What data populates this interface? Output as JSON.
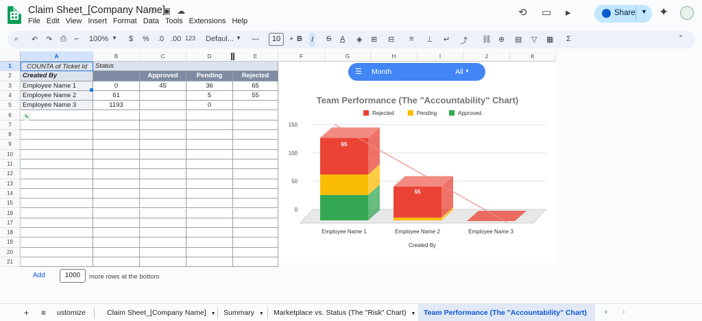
{
  "app": {
    "title": "Claim Sheet_[Company Name]"
  },
  "menu": [
    "File",
    "Edit",
    "View",
    "Insert",
    "Format",
    "Data",
    "Tools",
    "Extensions",
    "Help"
  ],
  "header": {
    "share_label": "Share"
  },
  "toolbar": {
    "zoom": "100%",
    "currency": "$",
    "percent": "%",
    "dec_decrease": ".0",
    "dec_increase": ".00",
    "number_format": "123",
    "font": "Defaul...",
    "font_size": "10",
    "bold": "B",
    "italic": "I",
    "sum": "Σ"
  },
  "columns": [
    "A",
    "B",
    "C",
    "D",
    "E",
    "F",
    "G",
    "H",
    "I",
    "J",
    "K"
  ],
  "rows": [
    "1",
    "2",
    "3",
    "4",
    "5",
    "6",
    "7",
    "8",
    "9",
    "10",
    "11",
    "12",
    "13",
    "14",
    "15",
    "16",
    "17",
    "18",
    "19",
    "20",
    "21"
  ],
  "table": {
    "a1": "COUNTA of Ticket Id",
    "b1": "Status",
    "a2": "Created By",
    "status_headers": [
      "Approved",
      "Pending",
      "Rejected"
    ],
    "rows": [
      {
        "name": "Employee Name 1",
        "total": "0",
        "approved": "45",
        "pending": "36",
        "rejected": "65"
      },
      {
        "name": "Employee Name 2",
        "total": "61",
        "approved": "",
        "pending": "5",
        "rejected": "55"
      },
      {
        "name": "Employee Name 3",
        "total": "1193",
        "approved": "",
        "pending": "0",
        "rejected": ""
      }
    ]
  },
  "filter": {
    "label": "Month",
    "value": "All"
  },
  "chart_data": {
    "type": "bar",
    "stacked": true,
    "three_d": true,
    "title": "Team Performance (The \"Accountability\" Chart)",
    "xlabel": "Created By",
    "ylabel": "",
    "categories": [
      "Employee Name 1",
      "Employee Name 2",
      "Employee Name 3"
    ],
    "series": [
      {
        "name": "Approved",
        "values": [
          45,
          0,
          0
        ],
        "color": "#34a853"
      },
      {
        "name": "Pending",
        "values": [
          36,
          5,
          0
        ],
        "color": "#fbbc04"
      },
      {
        "name": "Rejected",
        "values": [
          65,
          55,
          0
        ],
        "color": "#ea4335"
      }
    ],
    "legend_order": [
      "Rejected",
      "Pending",
      "Approved"
    ],
    "data_labels": {
      "Rejected": [
        "65",
        "55",
        ""
      ]
    },
    "yticks": [
      "150",
      "100",
      "50",
      "0"
    ],
    "ylim": [
      0,
      150
    ],
    "trendline": {
      "color": "#f28b82",
      "series": "Rejected"
    },
    "legend_position": "top",
    "grid": true
  },
  "bottom": {
    "add_label": "Add",
    "rows_count": "1000",
    "rows_text": "more rows at the bottom"
  },
  "sheets": [
    {
      "label": "ustomize",
      "active": false
    },
    {
      "label": "Claim Sheet_[Company Name]",
      "active": false
    },
    {
      "label": "Summary",
      "active": false
    },
    {
      "label": "Marketplace vs. Status (The \"Risk\" Chart)",
      "active": false
    },
    {
      "label": "Team Performance (The \"Accountability\" Chart)",
      "active": true
    }
  ]
}
